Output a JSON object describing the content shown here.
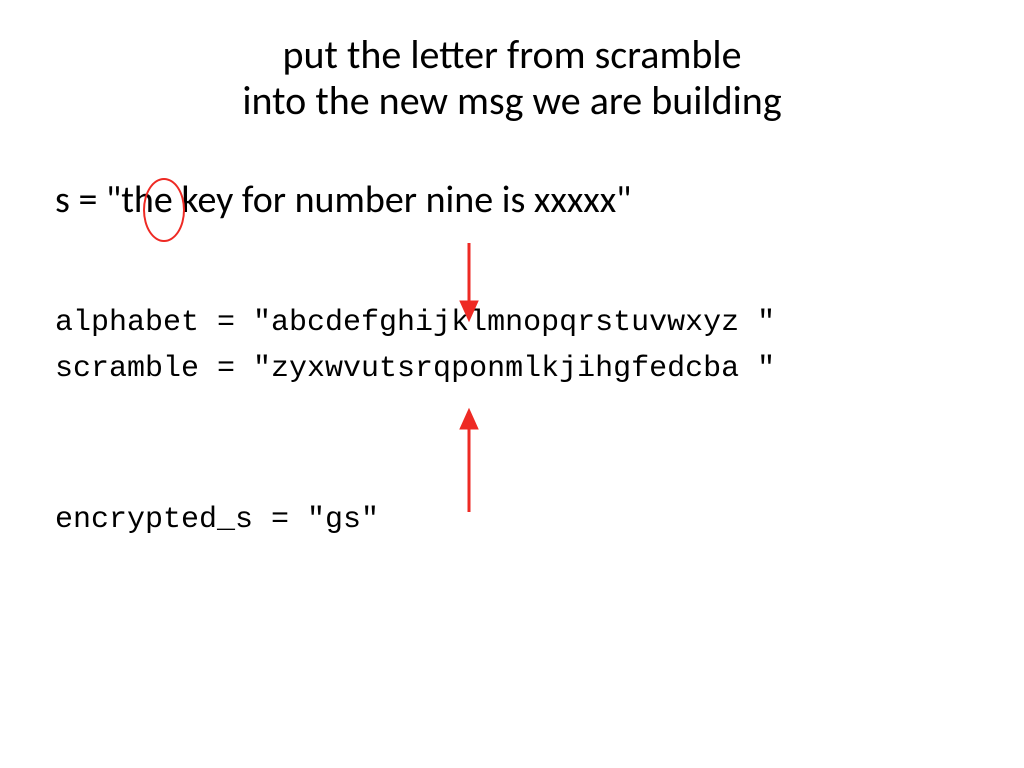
{
  "title_line1": "put the letter from scramble",
  "title_line2": "into the new msg we are building",
  "s_line": "s = \"the key for number nine is xxxxx\"",
  "alphabet_line": "alphabet = \"abcdefghijklmnopqrstuvwxyz \"",
  "scramble_line": "scramble = \"zyxwvutsrqponmlkjihgfedcba \"",
  "encrypted_line": "encrypted_s = \"gs\"",
  "colors": {
    "annotation": "#ee2a24"
  }
}
